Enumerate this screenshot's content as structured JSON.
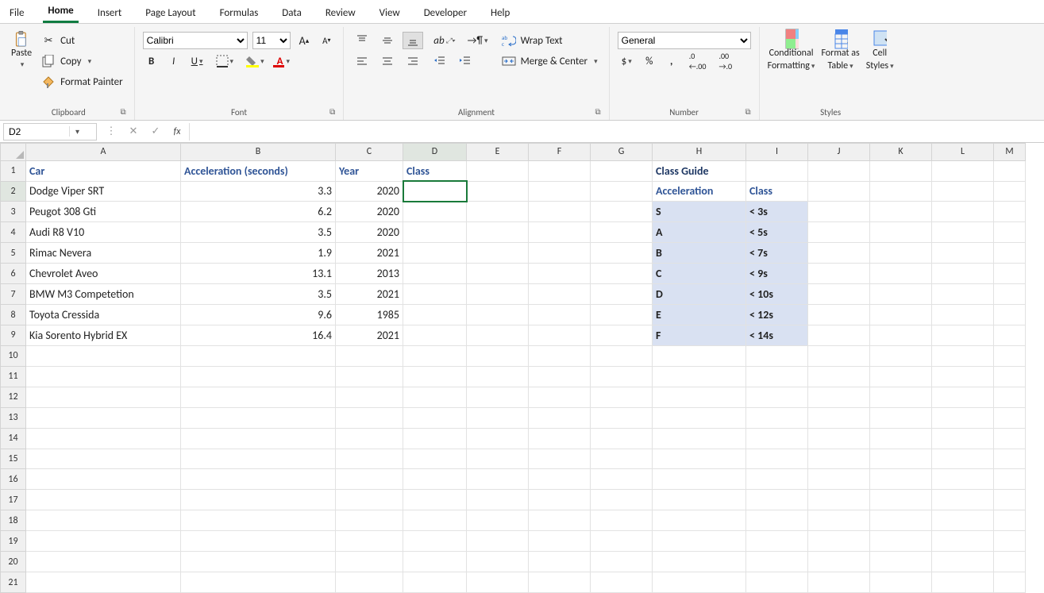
{
  "menu": {
    "items": [
      "File",
      "Home",
      "Insert",
      "Page Layout",
      "Formulas",
      "Data",
      "Review",
      "View",
      "Developer",
      "Help"
    ],
    "active": "Home"
  },
  "ribbon": {
    "clipboard": {
      "paste": "Paste",
      "cut": "Cut",
      "copy": "Copy",
      "format_painter": "Format Painter",
      "label": "Clipboard"
    },
    "font": {
      "name": "Calibri",
      "size": "11",
      "label": "Font"
    },
    "alignment": {
      "wrap": "Wrap Text",
      "merge": "Merge & Center",
      "label": "Alignment"
    },
    "number": {
      "format": "General",
      "label": "Number"
    },
    "styles": {
      "cond": "Conditional",
      "cond2": "Formatting",
      "table": "Format as",
      "table2": "Table",
      "cell": "Cell",
      "cell2": "Styles",
      "label": "Styles"
    }
  },
  "namebox": "D2",
  "formula": "",
  "columns": [
    "A",
    "B",
    "C",
    "D",
    "E",
    "F",
    "G",
    "H",
    "I",
    "J",
    "K",
    "L",
    "M"
  ],
  "data": {
    "headers": {
      "A": "Car",
      "B": "Acceleration (seconds)",
      "C": "Year",
      "D": "Class"
    },
    "rows": [
      {
        "car": "Dodge Viper SRT",
        "acc": "3.3",
        "year": "2020"
      },
      {
        "car": "Peugot 308 Gti",
        "acc": "6.2",
        "year": "2020"
      },
      {
        "car": "Audi R8 V10",
        "acc": "3.5",
        "year": "2020"
      },
      {
        "car": "Rimac Nevera",
        "acc": "1.9",
        "year": "2021"
      },
      {
        "car": "Chevrolet Aveo",
        "acc": "13.1",
        "year": "2013"
      },
      {
        "car": "BMW M3 Competetion",
        "acc": "3.5",
        "year": "2021"
      },
      {
        "car": "Toyota Cressida",
        "acc": "9.6",
        "year": "1985"
      },
      {
        "car": "Kia Sorento Hybrid EX",
        "acc": "16.4",
        "year": "2021"
      }
    ],
    "guide": {
      "title": "Class Guide",
      "acc_hdr": "Acceleration",
      "class_hdr": "Class",
      "rows": [
        {
          "cls": "S",
          "t": "< 3s"
        },
        {
          "cls": "A",
          "t": "< 5s"
        },
        {
          "cls": "B",
          "t": "< 7s"
        },
        {
          "cls": "C",
          "t": "< 9s"
        },
        {
          "cls": "D",
          "t": "< 10s"
        },
        {
          "cls": "E",
          "t": "< 12s"
        },
        {
          "cls": "F",
          "t": "< 14s"
        }
      ]
    }
  },
  "active_cell": "D2"
}
